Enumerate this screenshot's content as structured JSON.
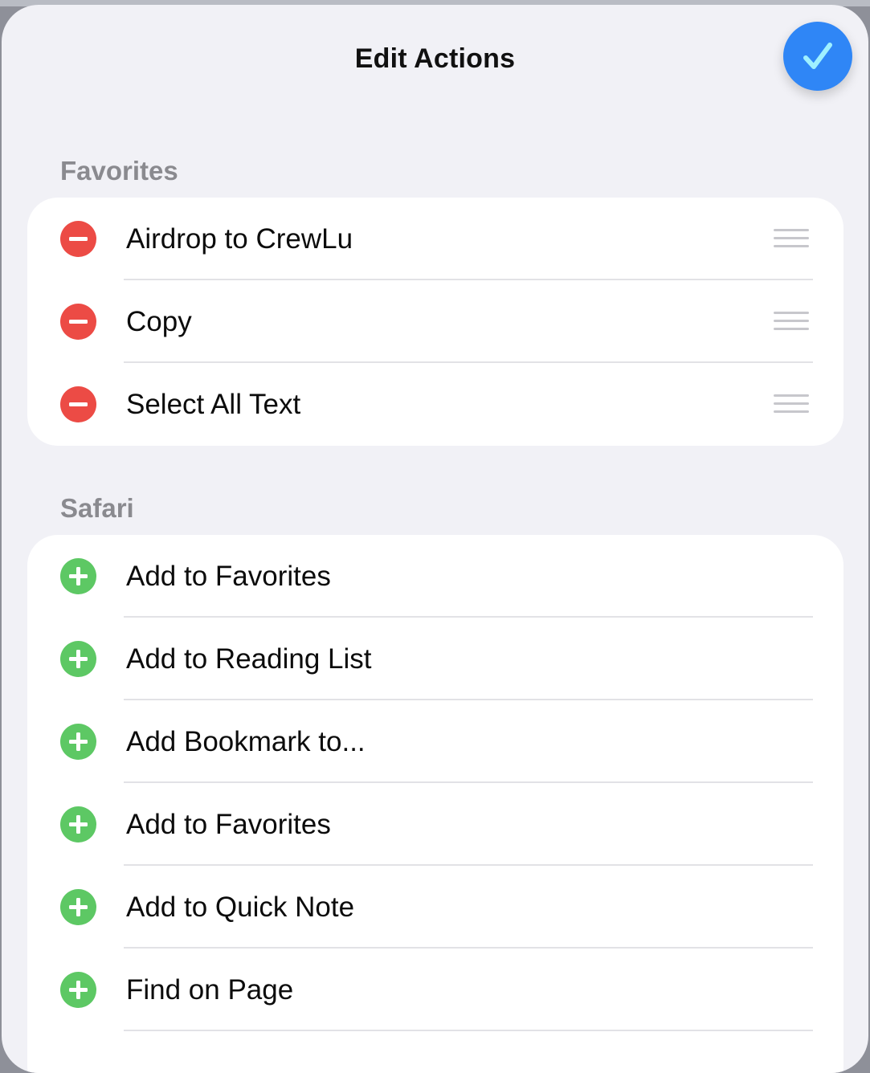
{
  "header": {
    "title": "Edit Actions",
    "done_icon": "checkmark-icon"
  },
  "favorites": {
    "header": "Favorites",
    "items": [
      {
        "label": "Airdrop to CrewLu",
        "action_icon": "remove-circle-icon",
        "reorder_icon": "reorder-handle-icon"
      },
      {
        "label": "Copy",
        "action_icon": "remove-circle-icon",
        "reorder_icon": "reorder-handle-icon"
      },
      {
        "label": "Select All Text",
        "action_icon": "remove-circle-icon",
        "reorder_icon": "reorder-handle-icon"
      }
    ]
  },
  "safari": {
    "header": "Safari",
    "items": [
      {
        "label": "Add to Favorites",
        "action_icon": "add-circle-icon"
      },
      {
        "label": "Add to Reading List",
        "action_icon": "add-circle-icon"
      },
      {
        "label": "Add Bookmark to...",
        "action_icon": "add-circle-icon"
      },
      {
        "label": "Add to Favorites",
        "action_icon": "add-circle-icon"
      },
      {
        "label": "Add to Quick Note",
        "action_icon": "add-circle-icon"
      },
      {
        "label": "Find on Page",
        "action_icon": "add-circle-icon"
      }
    ]
  },
  "colors": {
    "accent_blue": "#2f86f6",
    "remove_red": "#ec4b45",
    "add_green": "#5dc864",
    "sheet_background": "#f1f1f6",
    "section_header_gray": "#8a8a8f"
  }
}
